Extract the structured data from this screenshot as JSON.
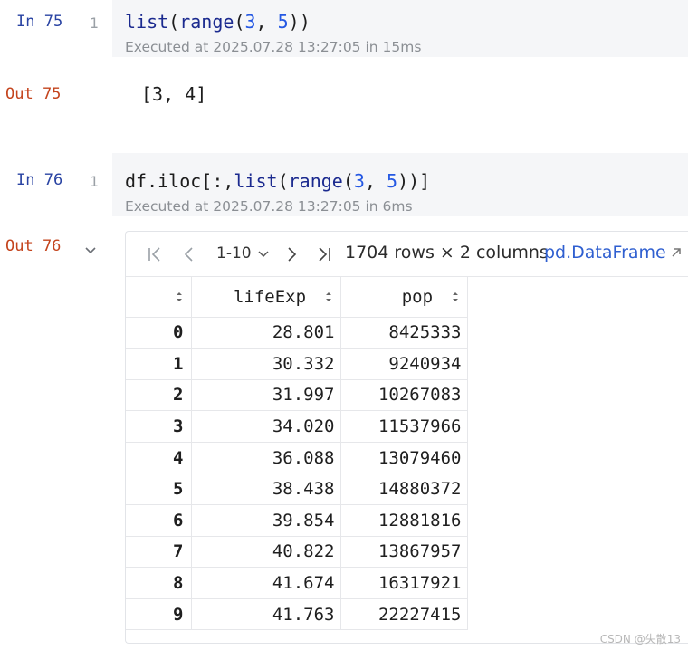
{
  "cells": [
    {
      "in_label": "In 75",
      "line": "1",
      "code": {
        "a": "list",
        "b": "(",
        "c": "range",
        "d": "(",
        "e": "3",
        "f": ", ",
        "g": "5",
        "h": "))"
      },
      "exec": "Executed at 2025.07.28 13:27:05 in 15ms",
      "out_label": "Out 75",
      "output": "[3, 4]"
    },
    {
      "in_label": "In 76",
      "line": "1",
      "code": {
        "a": "df.iloc[:,",
        "b": "list",
        "c": "(",
        "d": "range",
        "e": "(",
        "f": "3",
        "g": ", ",
        "h": "5",
        "i": "))]"
      },
      "exec": "Executed at 2025.07.28 13:27:05 in 6ms",
      "out_label": "Out 76"
    }
  ],
  "dataframe": {
    "page_range": "1-10",
    "rows_info": "1704 rows × 2 columns",
    "type_link": "pd.DataFrame",
    "columns": [
      "",
      "lifeExp",
      "pop"
    ],
    "rows": [
      [
        "0",
        "28.801",
        "8425333"
      ],
      [
        "1",
        "30.332",
        "9240934"
      ],
      [
        "2",
        "31.997",
        "10267083"
      ],
      [
        "3",
        "34.020",
        "11537966"
      ],
      [
        "4",
        "36.088",
        "13079460"
      ],
      [
        "5",
        "38.438",
        "14880372"
      ],
      [
        "6",
        "39.854",
        "12881816"
      ],
      [
        "7",
        "40.822",
        "13867957"
      ],
      [
        "8",
        "41.674",
        "16317921"
      ],
      [
        "9",
        "41.763",
        "22227415"
      ]
    ]
  },
  "watermark": "CSDN @失散13",
  "colors": {
    "in": "#2a44a3",
    "out": "#c4441d",
    "link": "#2f5fd0",
    "cell_bg": "#f5f6f8"
  }
}
